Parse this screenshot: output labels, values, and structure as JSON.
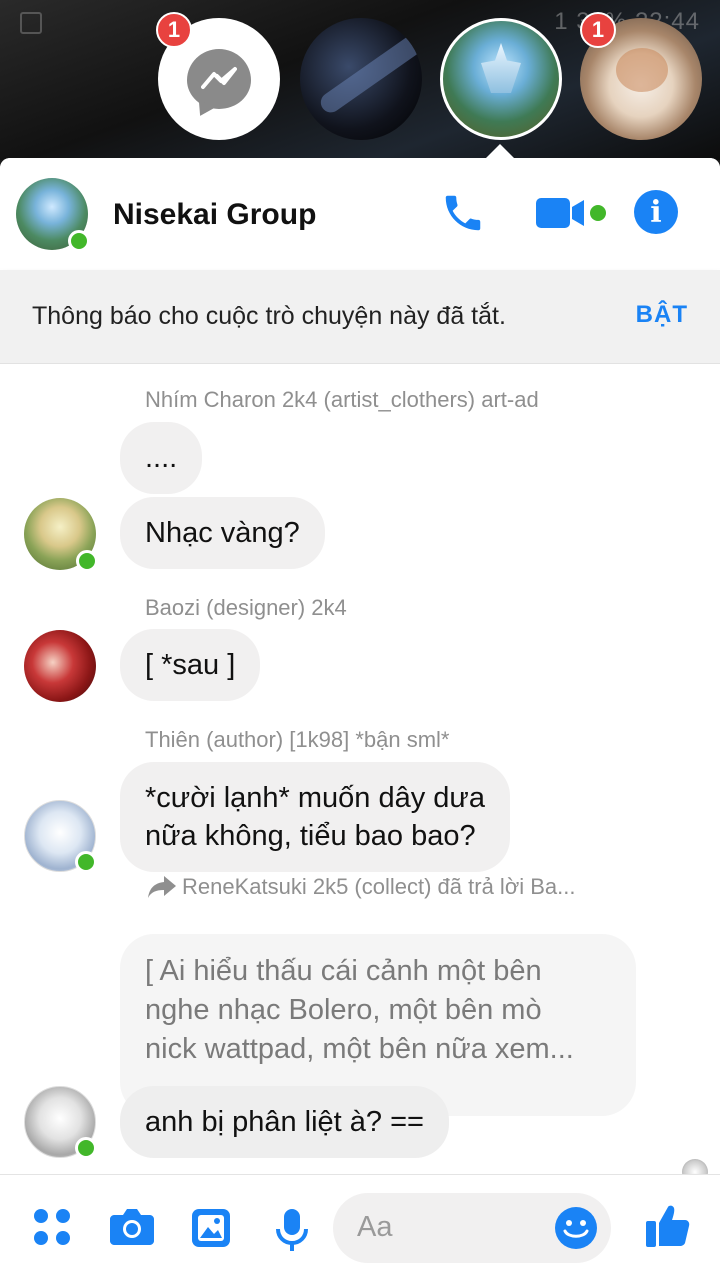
{
  "chat_heads": {
    "badge_1": "1",
    "badge_2": "1",
    "status_text": "1  34% 22:44"
  },
  "header": {
    "title": "Nisekai Group"
  },
  "notice": {
    "text": "Thông báo cho cuộc trò chuyện này đã tắt.",
    "action": "BẬT"
  },
  "messages": {
    "group1": {
      "sender": "Nhím Charon 2k4 (artist_clothers) art-ad",
      "msg1": "....",
      "msg2": "Nhạc vàng?"
    },
    "group2": {
      "sender": "Baozi (designer) 2k4",
      "msg1": "[ *sau ]"
    },
    "group3": {
      "sender": "Thiên (author) [1k98] *bận sml*",
      "line1": "*cười lạnh* muốn dây dưa",
      "line2": "nữa không, tiểu bao bao?"
    },
    "group4": {
      "reply_label": "ReneKatsuki 2k5 (collect) đã trả lời Ba...",
      "quote_line1": "[ Ai hiểu thấu cái cảnh một bên",
      "quote_line2": "nghe nhạc Bolero, một bên mò",
      "quote_line3": "nick wattpad, một bên nữa xem...",
      "msg1": "anh bị phân liệt à? =="
    }
  },
  "composer": {
    "placeholder": "Aa"
  },
  "colors": {
    "accent": "#1a83f5",
    "online": "#42b72a",
    "badge": "#e8423f"
  }
}
